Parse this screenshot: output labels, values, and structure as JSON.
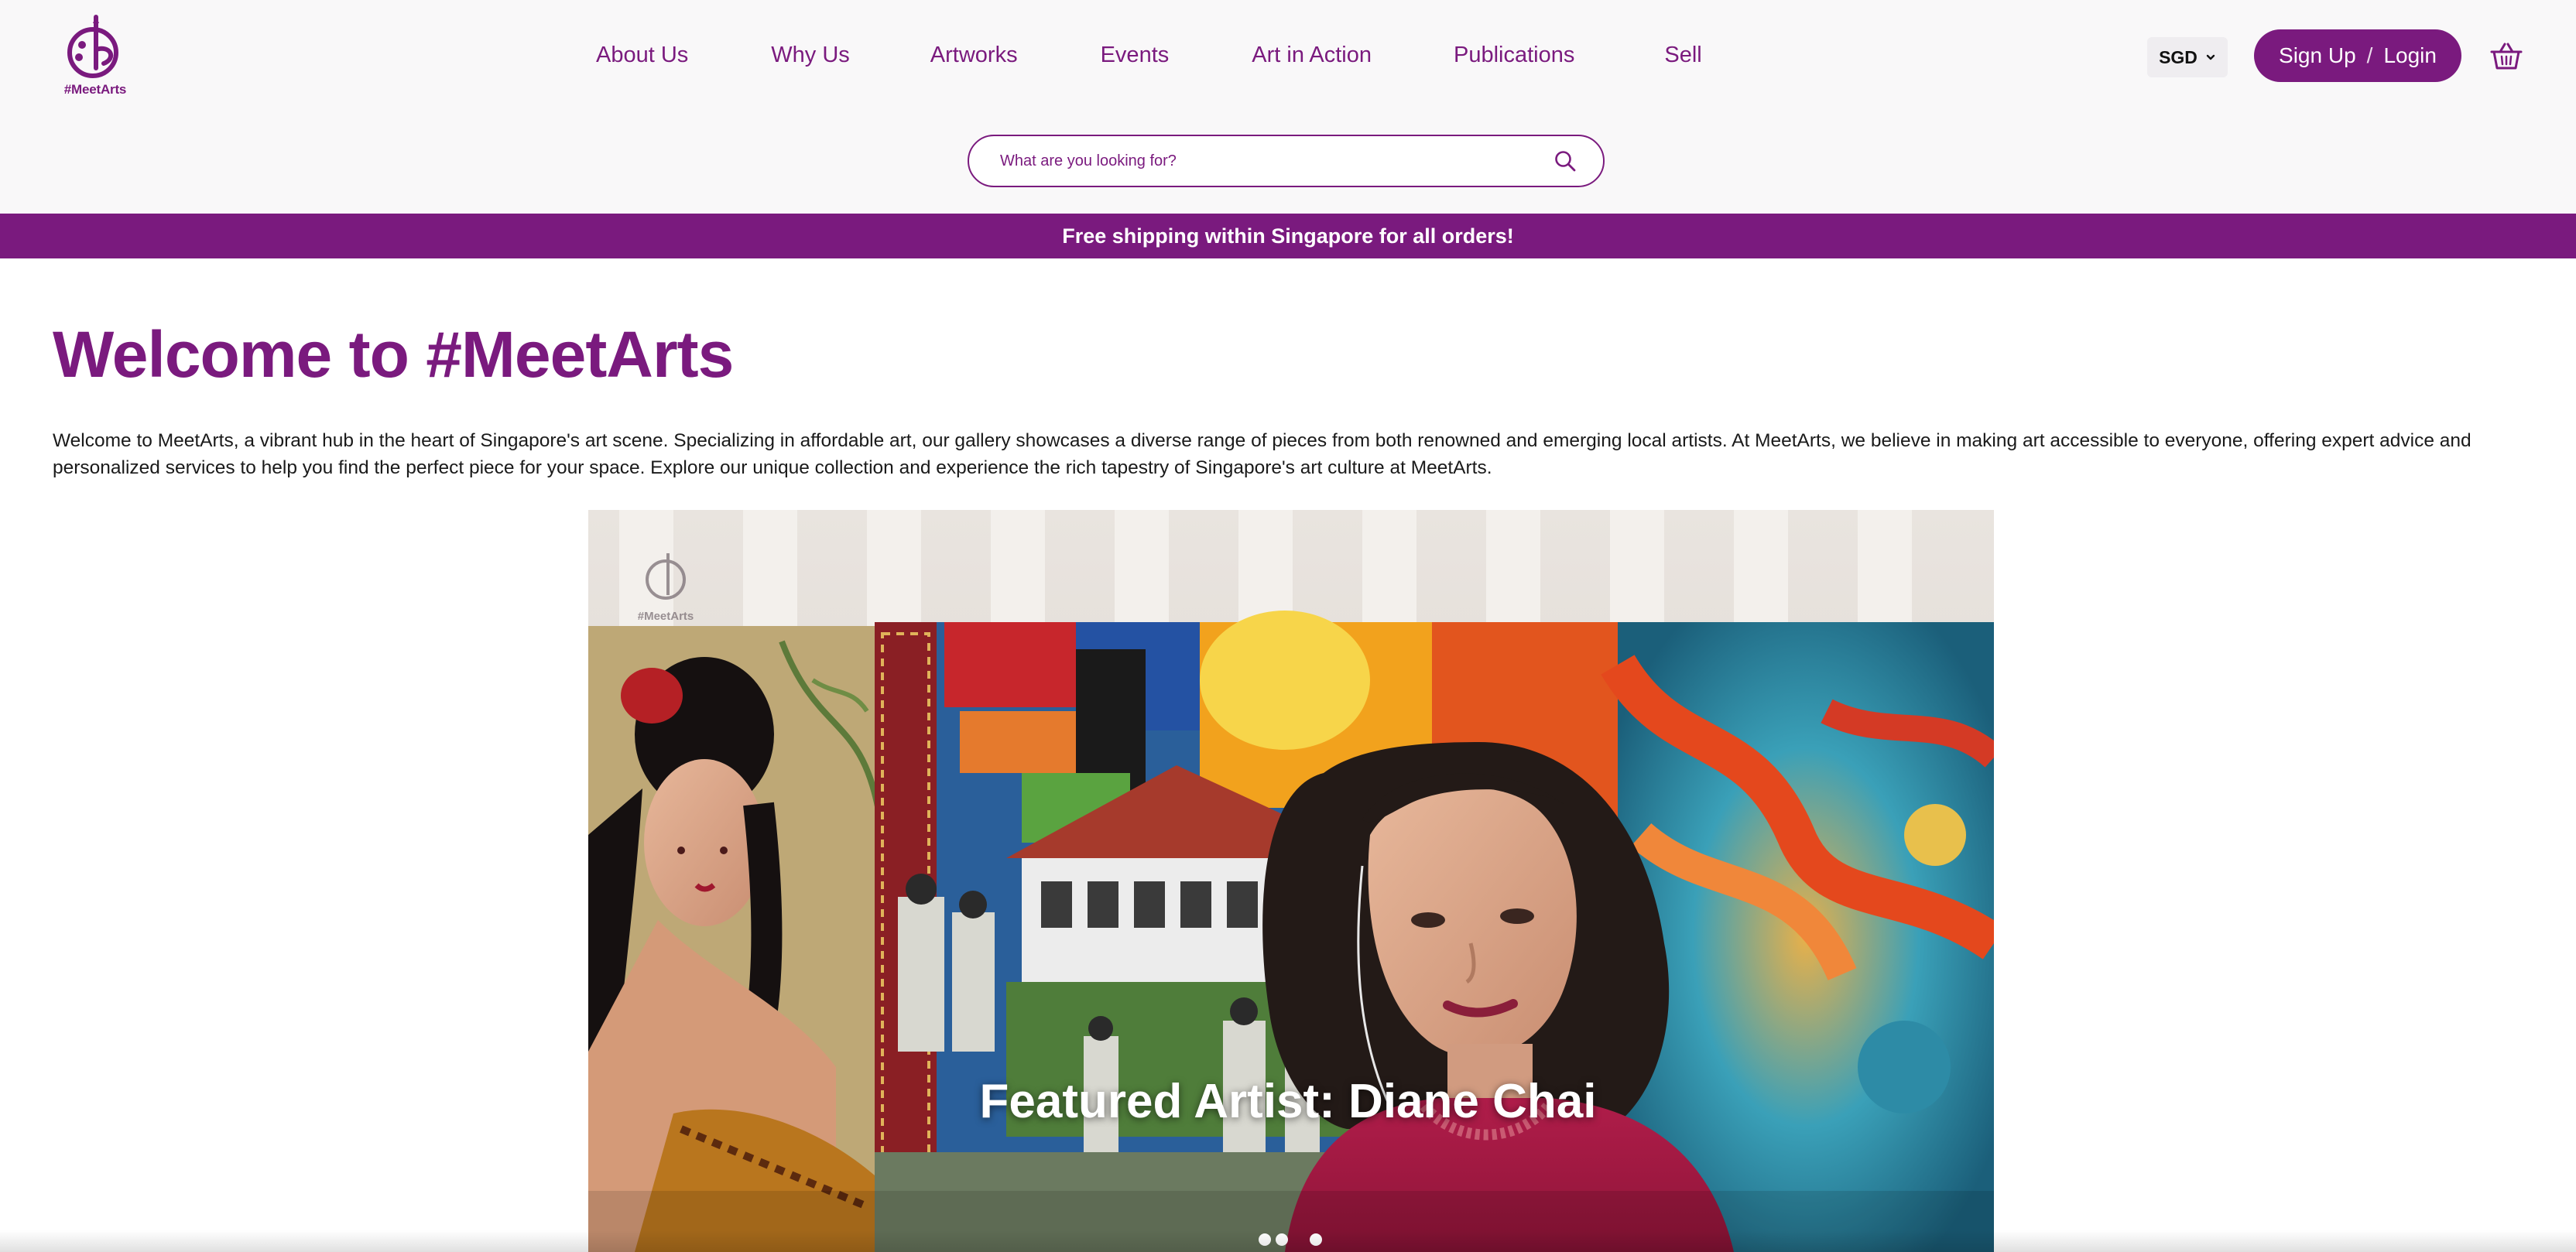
{
  "brand": {
    "logo_text": "#MeetArts",
    "accent_color": "#7a1a7e"
  },
  "nav": {
    "items": [
      {
        "label": "About Us"
      },
      {
        "label": "Why Us"
      },
      {
        "label": "Artworks"
      },
      {
        "label": "Events"
      },
      {
        "label": "Art in Action"
      },
      {
        "label": "Publications"
      },
      {
        "label": "Sell"
      }
    ]
  },
  "currency": {
    "selected": "SGD",
    "icon": "chevron-down-icon"
  },
  "auth": {
    "signup_label": "Sign Up",
    "separator": "/",
    "login_label": "Login"
  },
  "cart": {
    "icon": "basket-icon"
  },
  "search": {
    "placeholder": "What are you looking for?",
    "icon": "search-icon"
  },
  "banner": {
    "text": "Free shipping within Singapore for all orders!"
  },
  "main": {
    "title": "Welcome to #MeetArts",
    "intro": "Welcome to MeetArts, a vibrant hub in the heart of Singapore's art scene. Specializing in affordable art, our gallery showcases a diverse range of pieces from both renowned and emerging local artists. At MeetArts, we believe in making art accessible to everyone, offering expert advice and personalized services to help you find the perfect piece for your space. Explore our unique collection and experience the rich tapestry of Singapore's art culture at MeetArts."
  },
  "hero": {
    "caption": "Featured Artist: Diane Chai",
    "watermark_text": "#MeetArts",
    "slide_count": 3,
    "active_slide": 1
  }
}
